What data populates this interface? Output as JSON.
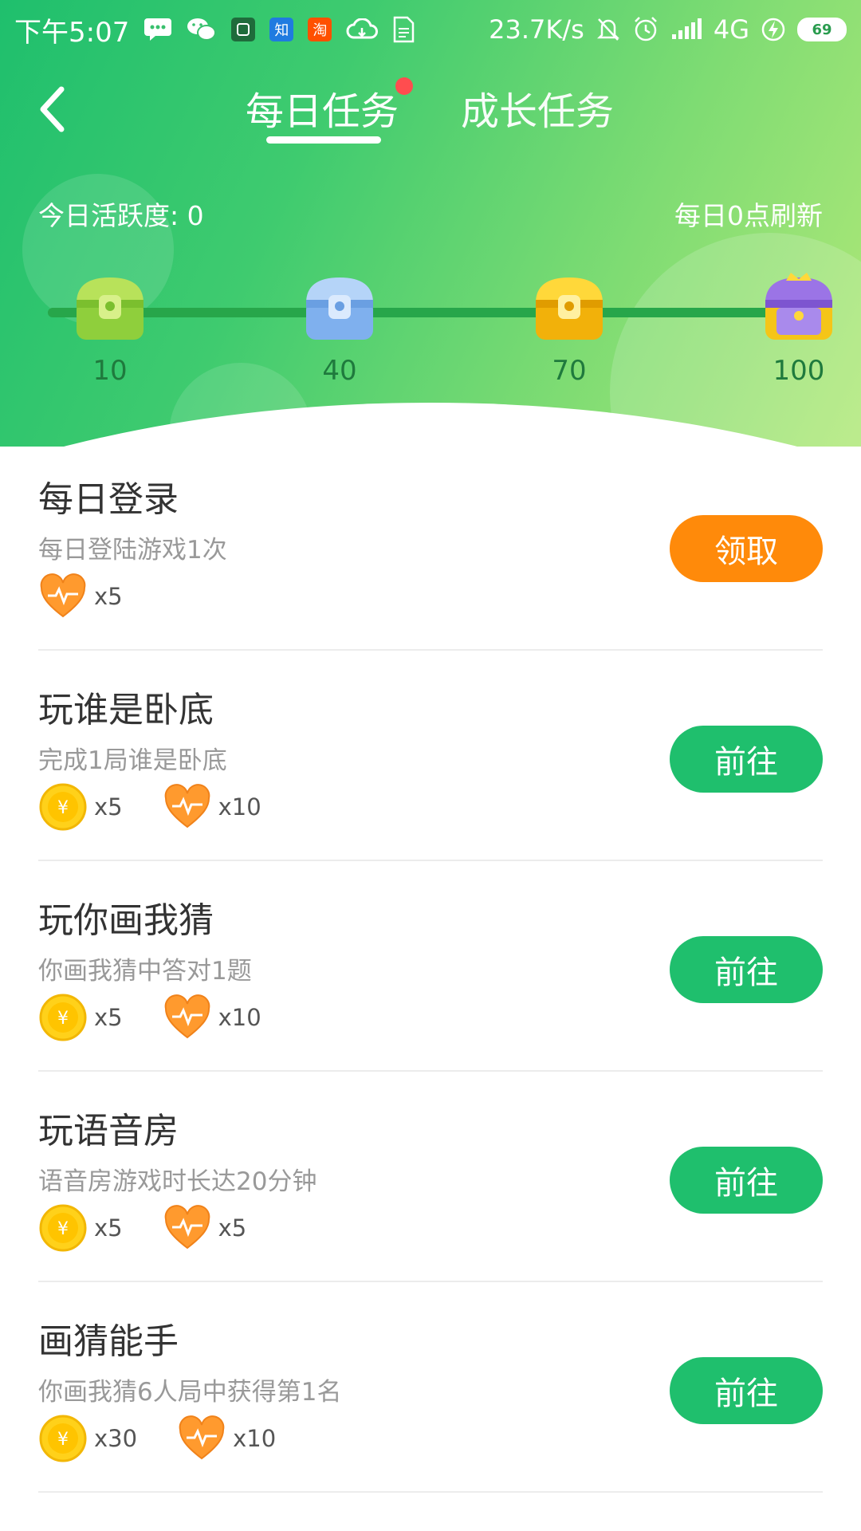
{
  "status_bar": {
    "time": "下午5:07",
    "app_icons": [
      "message-icon",
      "wechat-icon",
      "mi-icon",
      "zhihu-icon",
      "taobao-icon",
      "cloud-icon",
      "doc-icon"
    ],
    "zhihu_label": "知",
    "taobao_label": "淘",
    "network_speed": "23.7K/s",
    "network_type": "4G",
    "battery": "69"
  },
  "header": {
    "back_icon": "chevron-left-icon",
    "tabs": [
      {
        "label": "每日任务",
        "active": true,
        "has_dot": true
      },
      {
        "label": "成长任务",
        "active": false
      }
    ],
    "activity_text": "今日活跃度: 0",
    "refresh_text": "每日0点刷新",
    "milestones": [
      {
        "value": "10",
        "chest": "green-chest-icon",
        "color": "#a6d94a"
      },
      {
        "value": "40",
        "chest": "blue-chest-icon",
        "color": "#9cc3f3"
      },
      {
        "value": "70",
        "chest": "gold-chest-icon",
        "color": "#f9c515"
      },
      {
        "value": "100",
        "chest": "purple-chest-icon",
        "color": "#a07ce8"
      }
    ]
  },
  "tasks": [
    {
      "title": "每日登录",
      "desc": "每日登陆游戏1次",
      "rewards": [
        {
          "icon": "heart-icon",
          "qty": "x5"
        }
      ],
      "button": "领取",
      "button_type": "claim"
    },
    {
      "title": "玩谁是卧底",
      "desc": "完成1局谁是卧底",
      "rewards": [
        {
          "icon": "coin-icon",
          "qty": "x5"
        },
        {
          "icon": "heart-icon",
          "qty": "x10"
        }
      ],
      "button": "前往",
      "button_type": "go"
    },
    {
      "title": "玩你画我猜",
      "desc": "你画我猜中答对1题",
      "rewards": [
        {
          "icon": "coin-icon",
          "qty": "x5"
        },
        {
          "icon": "heart-icon",
          "qty": "x10"
        }
      ],
      "button": "前往",
      "button_type": "go"
    },
    {
      "title": "玩语音房",
      "desc": "语音房游戏时长达20分钟",
      "rewards": [
        {
          "icon": "coin-icon",
          "qty": "x5"
        },
        {
          "icon": "heart-icon",
          "qty": "x5"
        }
      ],
      "button": "前往",
      "button_type": "go"
    },
    {
      "title": "画猜能手",
      "desc": "你画我猜6人局中获得第1名",
      "rewards": [
        {
          "icon": "coin-icon",
          "qty": "x30"
        },
        {
          "icon": "heart-icon",
          "qty": "x10"
        }
      ],
      "button": "前往",
      "button_type": "go"
    }
  ],
  "colors": {
    "brand_green": "#1fbf6d",
    "claim_orange": "#ff8a0a",
    "badge_red": "#ff4d4f"
  }
}
